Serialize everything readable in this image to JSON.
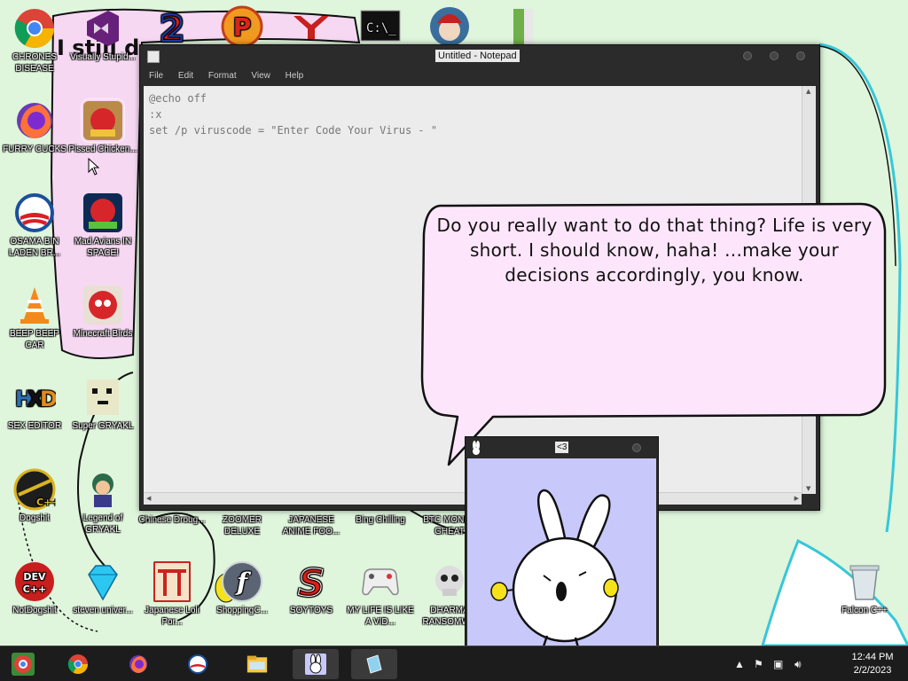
{
  "wallpaper": {
    "doodle_text": "I still d"
  },
  "desktop_icons": [
    {
      "label": "CHRONES DISEASE",
      "icon": "chrome-icon"
    },
    {
      "label": "Visually Stupid...",
      "icon": "visual-studio-icon"
    },
    {
      "label": "FURRY CUCKS",
      "icon": "firefox-icon"
    },
    {
      "label": "Pissed Chicken...",
      "icon": "angry-birds-seasons-icon"
    },
    {
      "label": "OSAMA BIN LADEN BR...",
      "icon": "obama-logo-icon"
    },
    {
      "label": "Mad Avians IN SPACE!",
      "icon": "angry-birds-space-icon"
    },
    {
      "label": "BEEP BEEP CAR",
      "icon": "vlc-cone-icon"
    },
    {
      "label": "Minecraft Birds",
      "icon": "angry-birds-icon"
    },
    {
      "label": "SEX EDITOR",
      "icon": "hxd-icon"
    },
    {
      "label": "Super GRYAKL",
      "icon": "pixel-cat-icon"
    },
    {
      "label": "Dogshit",
      "icon": "dev-cpp-icon"
    },
    {
      "label": "Legend of GRYAKL",
      "icon": "pixel-hero-icon"
    },
    {
      "label": "Chinese Droug...",
      "icon": "blank-icon"
    },
    {
      "label": "ZOOMER DELUXE",
      "icon": "blank-icon"
    },
    {
      "label": "JAPANESE ANIME FOO...",
      "icon": "blank-icon"
    },
    {
      "label": "Bing Chilling",
      "icon": "blank-icon"
    },
    {
      "label": "BTC MONEY GHEAT",
      "icon": "blank-icon"
    },
    {
      "label": "NotDogshit",
      "icon": "dev-cpp-red-icon"
    },
    {
      "label": "steven univer...",
      "icon": "diamond-icon"
    },
    {
      "label": "Japanese Loli Por...",
      "icon": "torii-icon"
    },
    {
      "label": "ShoppingC...",
      "icon": "flash-icon"
    },
    {
      "label": "SOYTOYS",
      "icon": "soy-s-icon"
    },
    {
      "label": "MY LIFE IS LIKE A VID...",
      "icon": "gamepad-icon"
    },
    {
      "label": "DHARMA RANSOMW...",
      "icon": "skull-icon"
    },
    {
      "label": "Falcon C++",
      "icon": "recycle-bin-icon"
    }
  ],
  "top_row_icons": [
    {
      "icon": "number-2-icon"
    },
    {
      "icon": "p-ball-icon"
    },
    {
      "icon": "red-bird-logo-icon"
    },
    {
      "icon": "cmd-icon"
    },
    {
      "icon": "santa-icon"
    },
    {
      "icon": "folder-book-icon"
    }
  ],
  "notepad": {
    "title": "Untitled - Notepad",
    "menu": [
      "File",
      "Edit",
      "Format",
      "View",
      "Help"
    ],
    "content_lines": [
      "@echo off",
      ":x",
      "set /p viruscode = \"Enter Code Your Virus - \""
    ]
  },
  "speech_bubble": {
    "text": "Do you really want to do that thing? Life is very short. I should know, haha! ...make your decisions accordingly, you know."
  },
  "bunny_window": {
    "title": "<3"
  },
  "taskbar": {
    "buttons": [
      {
        "icon": "start-chrome-icon",
        "active": false
      },
      {
        "icon": "chrome-icon",
        "active": false
      },
      {
        "icon": "firefox-icon",
        "active": false
      },
      {
        "icon": "obama-logo-icon",
        "active": false
      },
      {
        "icon": "file-explorer-icon",
        "active": false
      },
      {
        "icon": "bunny-icon",
        "active": true
      },
      {
        "icon": "notepad-icon",
        "active": true
      }
    ],
    "clock": {
      "time": "12:44 PM",
      "date": "2/2/2023"
    }
  },
  "colors": {
    "desktop_bg": "#dff5dc",
    "bubble_fill": "#fde6fb",
    "bunny_bg": "#c8c8fa",
    "taskbar_bg": "#1c1c1c"
  }
}
